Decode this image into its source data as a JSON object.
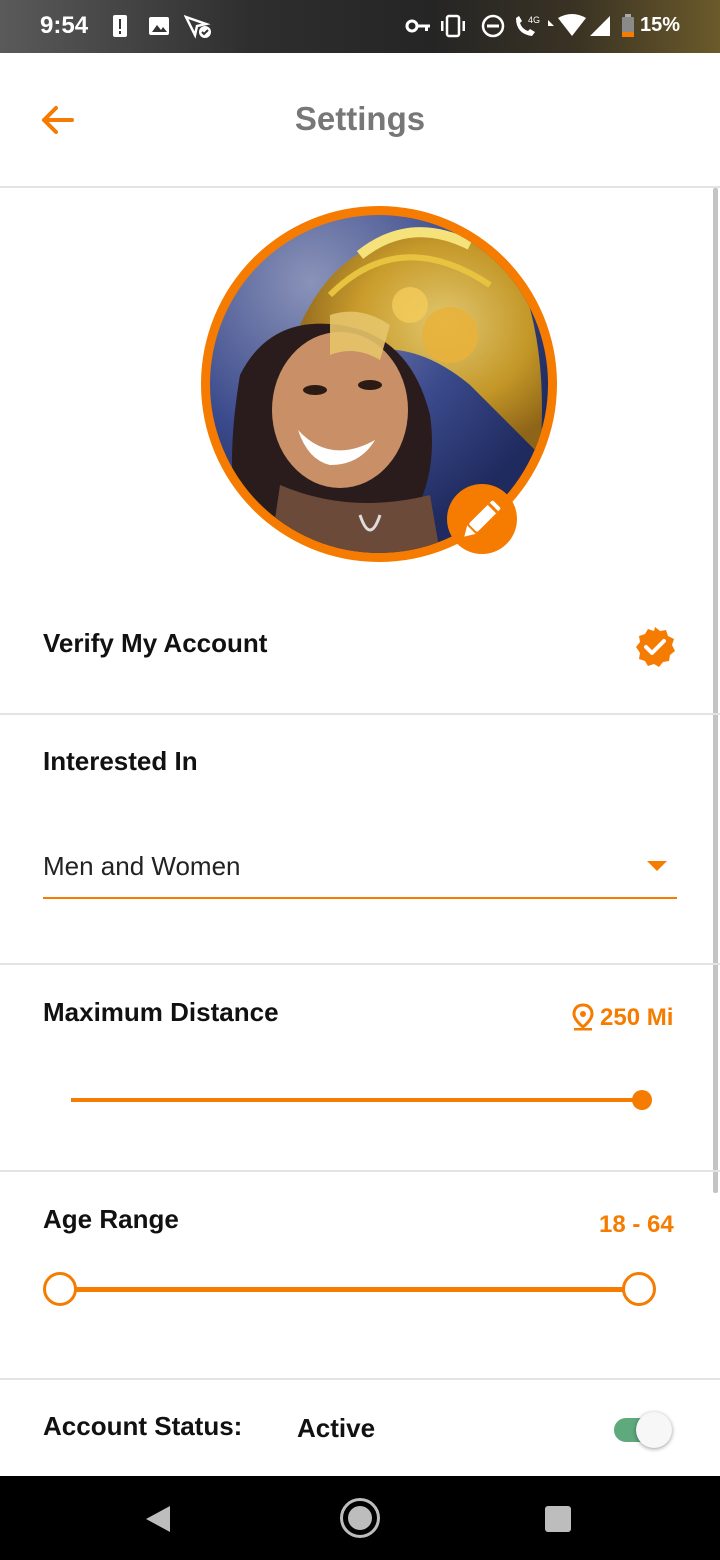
{
  "status_bar": {
    "time": "9:54",
    "battery_percent": "15%",
    "network_label": "4G",
    "icons": [
      "alert-icon",
      "image-icon",
      "location-off-icon",
      "vpn-key-icon",
      "vibrate-icon",
      "dnd-icon",
      "wifi-calling-icon",
      "wifi-icon",
      "signal-icon",
      "battery-icon"
    ]
  },
  "header": {
    "title": "Settings",
    "back_icon": "arrow-left-icon"
  },
  "profile": {
    "edit_icon": "pencil-icon"
  },
  "verify": {
    "label": "Verify My Account",
    "verified": true,
    "icon": "verified-badge-icon"
  },
  "interested_in": {
    "label": "Interested In",
    "selected": "Men and Women"
  },
  "max_distance": {
    "label": "Maximum Distance",
    "value": "250 Mi",
    "icon": "location-pin-icon",
    "fraction": 1.0
  },
  "age_range": {
    "label": "Age Range",
    "value": "18 - 64",
    "min": 18,
    "max": 64
  },
  "account_status": {
    "label": "Account Status:",
    "value": "Active",
    "toggle_on": true
  },
  "nav_bar": {
    "icons": [
      "back-triangle-icon",
      "home-circle-icon",
      "recents-square-icon"
    ]
  },
  "colors": {
    "accent": "#f57c00",
    "toggle_on": "#5faa7c",
    "title_gray": "#777777"
  }
}
